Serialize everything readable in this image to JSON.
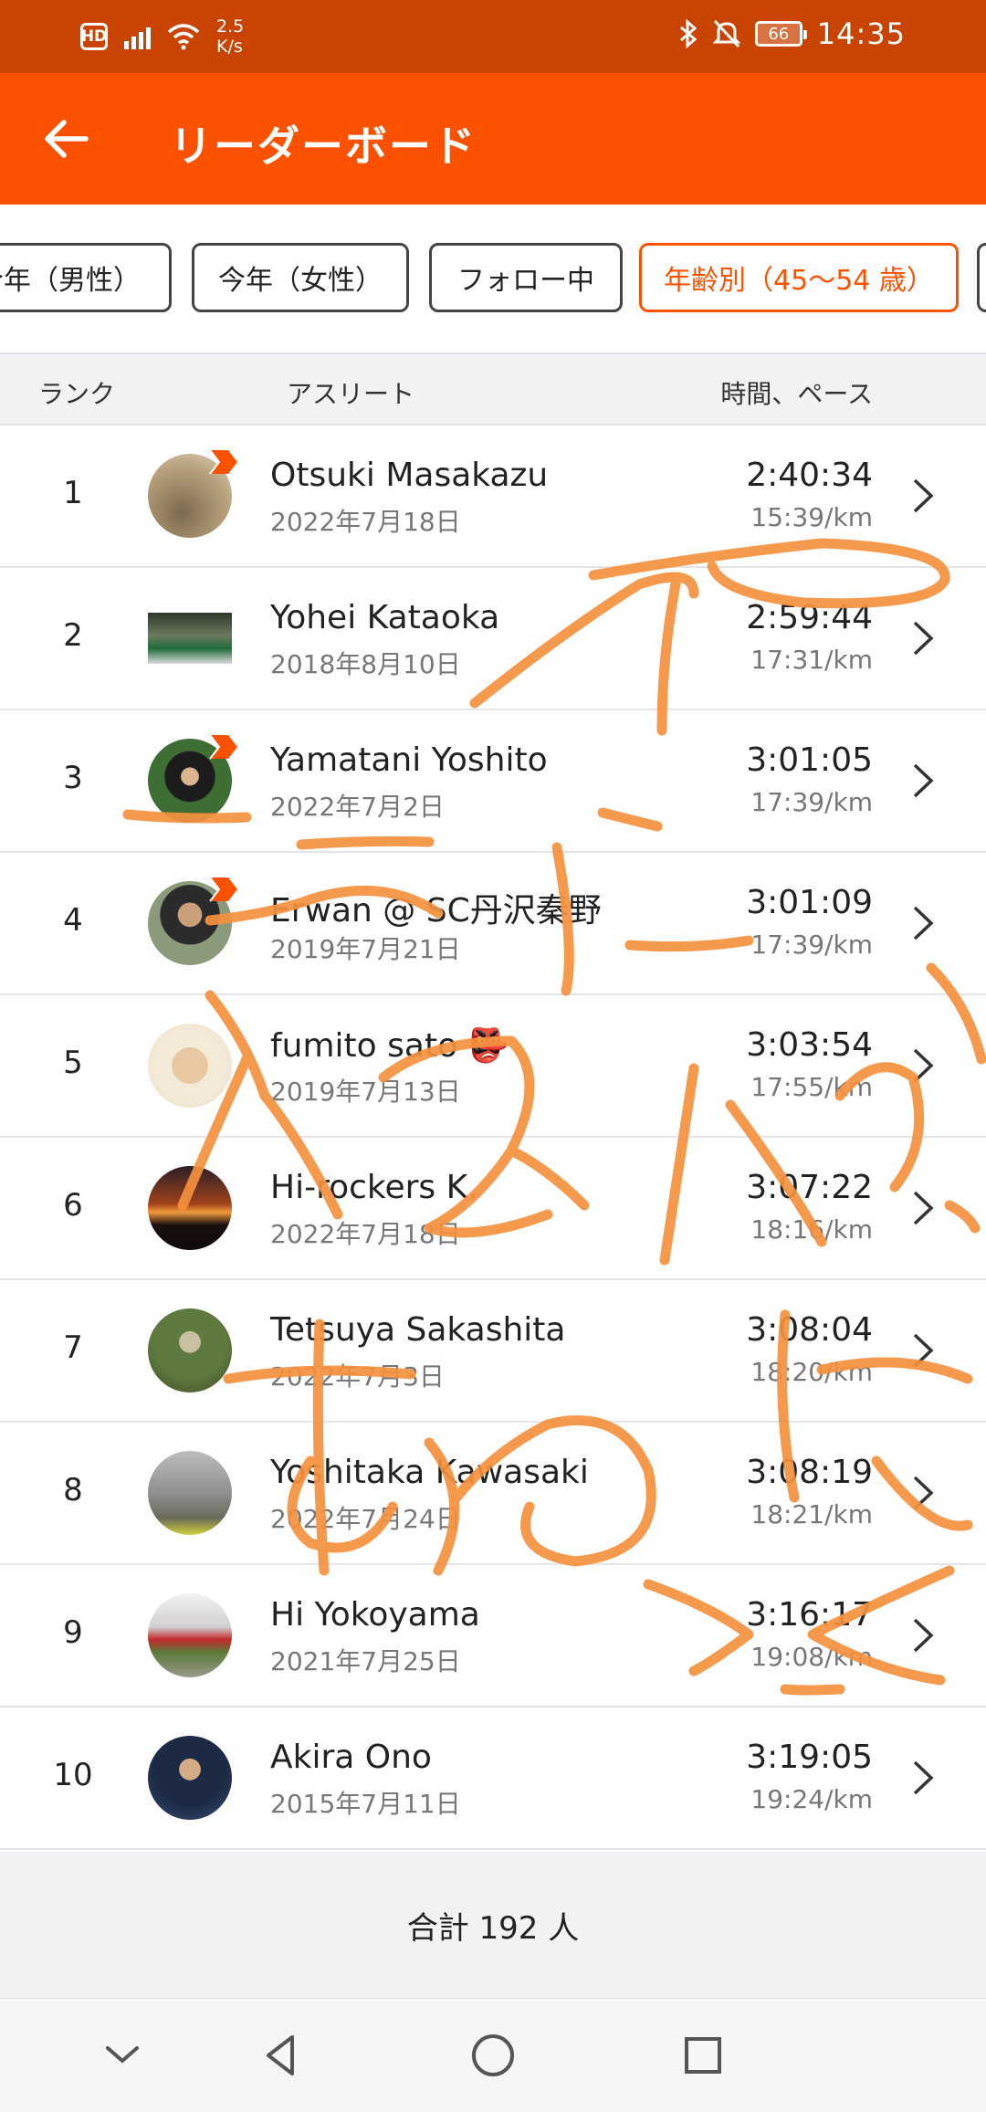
{
  "status_bar": {
    "hd": "HD",
    "speed_value": "2.5",
    "speed_unit": "K/s",
    "battery": "66",
    "time": "14:35",
    "icons": [
      "signal-icon",
      "wifi-icon",
      "bluetooth-icon",
      "mute-icon",
      "battery-icon"
    ]
  },
  "app_bar": {
    "title": "リーダーボード",
    "back_icon": "back-arrow-icon"
  },
  "filters": [
    {
      "label": "今年（男性）",
      "active": false
    },
    {
      "label": "今年（女性）",
      "active": false
    },
    {
      "label": "フォロー中",
      "active": false
    },
    {
      "label": "年齢別（45〜54 歳）",
      "active": true
    }
  ],
  "columns": {
    "rank": "ランク",
    "athlete": "アスリート",
    "time_pace": "時間、ペース"
  },
  "rows": [
    {
      "rank": "1",
      "name": "Otsuki Masakazu",
      "date": "2022年7月18日",
      "time": "2:40:34",
      "pace": "15:39/km",
      "subscriber": true
    },
    {
      "rank": "2",
      "name": "Yohei Kataoka",
      "date": "2018年8月10日",
      "time": "2:59:44",
      "pace": "17:31/km",
      "subscriber": false
    },
    {
      "rank": "3",
      "name": "Yamatani Yoshito",
      "date": "2022年7月2日",
      "time": "3:01:05",
      "pace": "17:39/km",
      "subscriber": true
    },
    {
      "rank": "4",
      "name": "Erwan @ SC丹沢秦野",
      "date": "2019年7月21日",
      "time": "3:01:09",
      "pace": "17:39/km",
      "subscriber": true
    },
    {
      "rank": "5",
      "name": "fumito sato 👺",
      "date": "2019年7月13日",
      "time": "3:03:54",
      "pace": "17:55/km",
      "subscriber": false
    },
    {
      "rank": "6",
      "name": "Hi-rockers K.",
      "date": "2022年7月18日",
      "time": "3:07:22",
      "pace": "18:16/km",
      "subscriber": false
    },
    {
      "rank": "7",
      "name": "Tetsuya Sakashita",
      "date": "2022年7月3日",
      "time": "3:08:04",
      "pace": "18:20/km",
      "subscriber": false
    },
    {
      "rank": "8",
      "name": "Yoshitaka Kawasaki",
      "date": "2022年7月24日",
      "time": "3:08:19",
      "pace": "18:21/km",
      "subscriber": false
    },
    {
      "rank": "9",
      "name": "Hi Yokoyama",
      "date": "2021年7月25日",
      "time": "3:16:17",
      "pace": "19:08/km",
      "subscriber": false
    },
    {
      "rank": "10",
      "name": "Akira Ono",
      "date": "2015年7月11日",
      "time": "3:19:05",
      "pace": "19:24/km",
      "subscriber": false
    }
  ],
  "footer": {
    "total": "合計 192 人"
  },
  "nav": [
    "collapse-icon",
    "back-triangle-icon",
    "home-circle-icon",
    "recents-square-icon"
  ],
  "colors": {
    "accent": "#fc5200",
    "status_bar": "#c94400",
    "scribble": "#f5913e"
  }
}
